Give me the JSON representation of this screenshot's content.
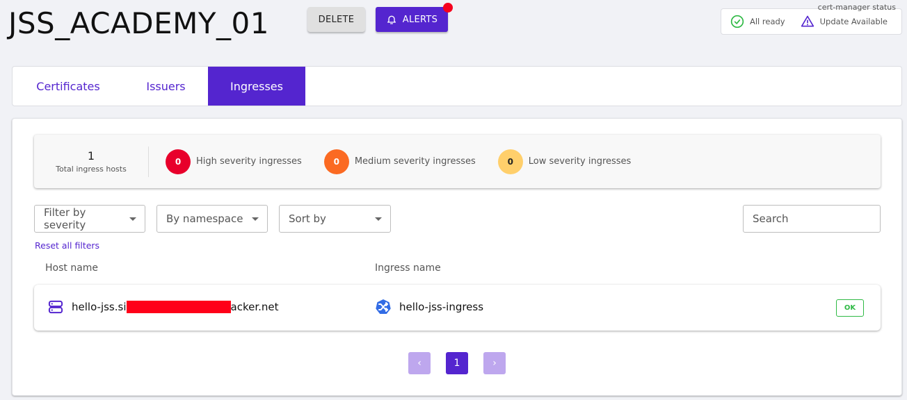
{
  "header": {
    "title": "JSS_ACADEMY_01",
    "delete_label": "DELETE",
    "alerts_label": "ALERTS",
    "alerts_has_notification": true
  },
  "cert_manager_status": {
    "caption": "cert-manager status",
    "items": [
      {
        "icon": "check-circle-icon",
        "label": "All ready",
        "color": "#2eb944"
      },
      {
        "icon": "warning-triangle-icon",
        "label": "Update Available",
        "color": "#5425cf"
      }
    ]
  },
  "tabs": [
    {
      "label": "Certificates",
      "active": false
    },
    {
      "label": "Issuers",
      "active": false
    },
    {
      "label": "Ingresses",
      "active": true
    }
  ],
  "summary": {
    "total_value": "1",
    "total_label": "Total ingress hosts",
    "severities": [
      {
        "count": "0",
        "label": "High severity ingresses",
        "color": "#e8002b",
        "text_color": "#ffffff"
      },
      {
        "count": "0",
        "label": "Medium severity ingresses",
        "color": "#fb6a22",
        "text_color": "#ffffff"
      },
      {
        "count": "0",
        "label": "Low severity ingresses",
        "color": "#ffcf6b",
        "text_color": "#222222"
      }
    ]
  },
  "filters": {
    "severity": "Filter by severity",
    "namespace": "By namespace",
    "sort": "Sort by",
    "search_placeholder": "Search",
    "reset_label": "Reset all filters"
  },
  "table": {
    "columns": [
      "Host name",
      "Ingress name"
    ],
    "rows": [
      {
        "host_prefix": "hello-jss.si",
        "host_redacted": true,
        "host_suffix": "acker.net",
        "ingress": "hello-jss-ingress",
        "status": "OK"
      }
    ]
  },
  "pagination": {
    "prev": "‹",
    "current": "1",
    "next": "›"
  },
  "colors": {
    "accent": "#5425cf",
    "ok": "#2eb944",
    "background": "#f1f2f6"
  }
}
